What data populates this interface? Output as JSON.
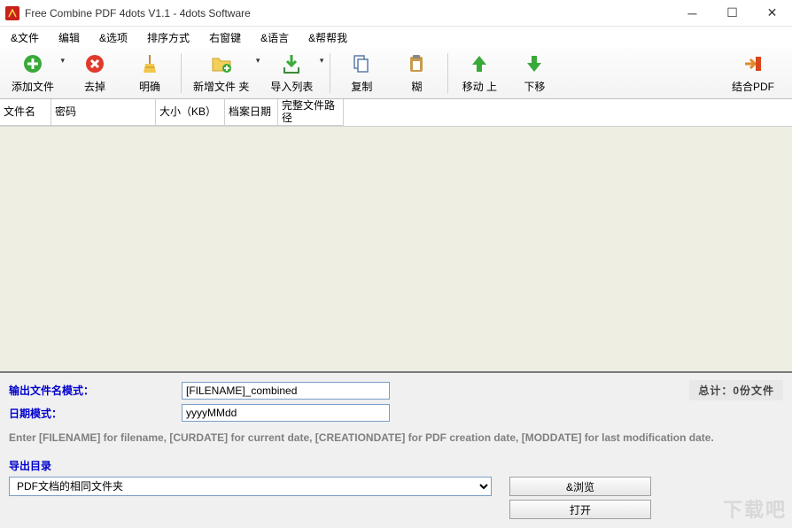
{
  "window": {
    "title": "Free Combine PDF 4dots V1.1 - 4dots Software"
  },
  "menu": {
    "file": "&文件",
    "edit": "编辑",
    "options": "&选项",
    "sort": "排序方式",
    "rightkey": "右窗键",
    "language": "&语言",
    "help": "&帮帮我"
  },
  "toolbar": {
    "add_file": "添加文件",
    "remove": "去掉",
    "clear": "明确",
    "new_folder": "新增文件 夹",
    "import_list": "导入列表",
    "copy": "复制",
    "paste": "糊",
    "move_up": "移动 上",
    "move_down": "下移",
    "combine_pdf": "结合PDF"
  },
  "grid": {
    "headers": {
      "filename": "文件名",
      "password": "密码",
      "size": "大小（KB）",
      "archive_date": "档案日期",
      "full_path": "完整文件路径"
    }
  },
  "bottom": {
    "output_pattern_label": "输出文件名模式：",
    "output_pattern_value": "[FILENAME]_combined",
    "date_pattern_label": "日期模式：",
    "date_pattern_value": "yyyyMMdd",
    "total_label": "总计：0份文件",
    "hint": "Enter [FILENAME] for filename, [CURDATE] for current date, [CREATIONDATE] for PDF creation date, [MODDATE] for last modification date.",
    "outdir_label": "导出目录",
    "outdir_selected": "PDF文档的相同文件夹",
    "browse_btn": "&浏览",
    "open_btn": "打开"
  },
  "watermark": "下载吧"
}
